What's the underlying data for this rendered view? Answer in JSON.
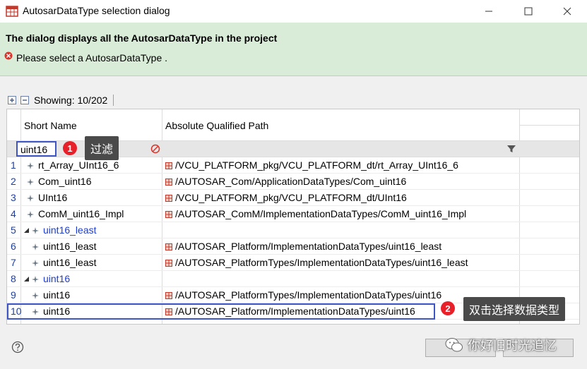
{
  "window": {
    "title": "AutosarDataType selection dialog",
    "icon": "table-app-icon"
  },
  "banner": {
    "title": "The dialog displays all the AutosarDataType in the project",
    "message": "Please select a AutosarDataType ."
  },
  "toolbar": {
    "showing": "Showing: 10/202"
  },
  "grid": {
    "headers": {
      "short_name": "Short Name",
      "path": "Absolute Qualified Path"
    },
    "filter_value": "uint16",
    "rows": [
      {
        "num": "1",
        "name": "rt_Array_UInt16_6",
        "path": "/VCU_PLATFORM_pkg/VCU_PLATFORM_dt/rt_Array_UInt16_6"
      },
      {
        "num": "2",
        "name": "Com_uint16",
        "path": "/AUTOSAR_Com/ApplicationDataTypes/Com_uint16"
      },
      {
        "num": "3",
        "name": "UInt16",
        "path": "/VCU_PLATFORM_pkg/VCU_PLATFORM_dt/UInt16"
      },
      {
        "num": "4",
        "name": "ComM_uint16_Impl",
        "path": "/AUTOSAR_ComM/ImplementationDataTypes/ComM_uint16_Impl"
      },
      {
        "num": "5",
        "name": "uint16_least",
        "path": ""
      },
      {
        "num": "6",
        "name": "uint16_least",
        "path": "/AUTOSAR_Platform/ImplementationDataTypes/uint16_least"
      },
      {
        "num": "7",
        "name": "uint16_least",
        "path": "/AUTOSAR_PlatformTypes/ImplementationDataTypes/uint16_least"
      },
      {
        "num": "8",
        "name": "uint16",
        "path": ""
      },
      {
        "num": "9",
        "name": "uint16",
        "path": "/AUTOSAR_PlatformTypes/ImplementationDataTypes/uint16"
      },
      {
        "num": "10",
        "name": "uint16",
        "path": "/AUTOSAR_Platform/ImplementationDataTypes/uint16"
      }
    ]
  },
  "annotations": [
    {
      "num": "1",
      "label": "过滤"
    },
    {
      "num": "2",
      "label": "双击选择数据类型"
    }
  ],
  "footer": {
    "watermark": "你好旧时光追忆"
  },
  "colors": {
    "banner_bg": "#d9ecd7",
    "highlight_border": "#3d55c5",
    "annotation_dot": "#e8202a",
    "link_text": "#1c3cd6"
  }
}
